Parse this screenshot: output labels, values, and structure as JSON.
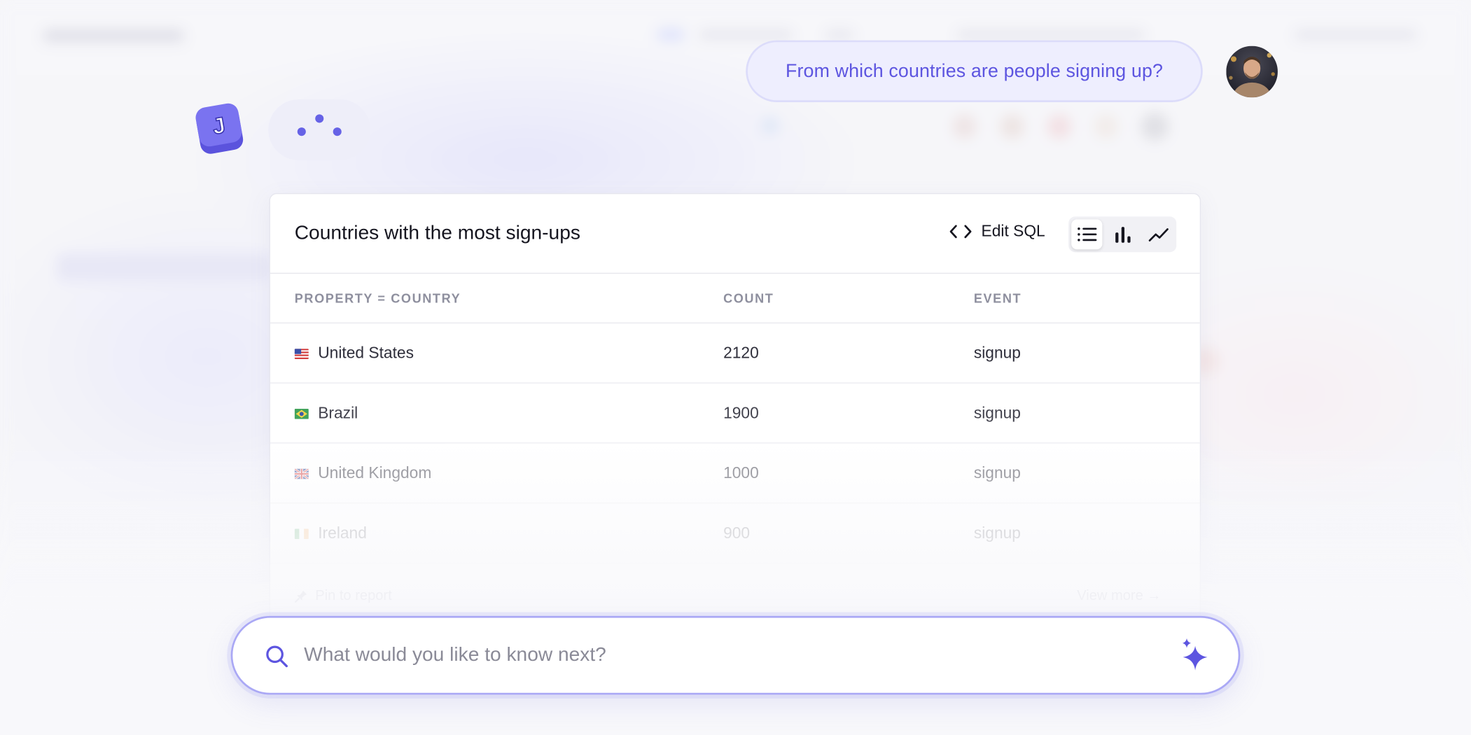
{
  "conversation": {
    "user_message": "From which countries are people signing up?"
  },
  "results_card": {
    "title": "Countries with the most sign-ups",
    "edit_sql_label": "Edit SQL",
    "view_modes": [
      "table",
      "bar-chart",
      "line-chart"
    ],
    "active_view": "table",
    "columns": [
      "PROPERTY = COUNTRY",
      "COUNT",
      "EVENT"
    ],
    "rows": [
      {
        "country": "United States",
        "count": "2120",
        "event": "signup",
        "flag": "us-flag"
      },
      {
        "country": "Brazil",
        "count": "1900",
        "event": "signup",
        "flag": "brazil-flag"
      },
      {
        "country": "United Kingdom",
        "count": "1000",
        "event": "signup",
        "flag": "uk-flag"
      },
      {
        "country": "Ireland",
        "count": "900",
        "event": "signup",
        "flag": "ireland-flag"
      }
    ],
    "footer": {
      "pin_label": "Pin to report",
      "view_more_label": "View more →"
    }
  },
  "search": {
    "placeholder": "What would you like to know next?",
    "value": ""
  },
  "colors": {
    "accent": "#5d55e0",
    "bubble_bg": "#eeeefe",
    "logo": "#6b63e8"
  }
}
